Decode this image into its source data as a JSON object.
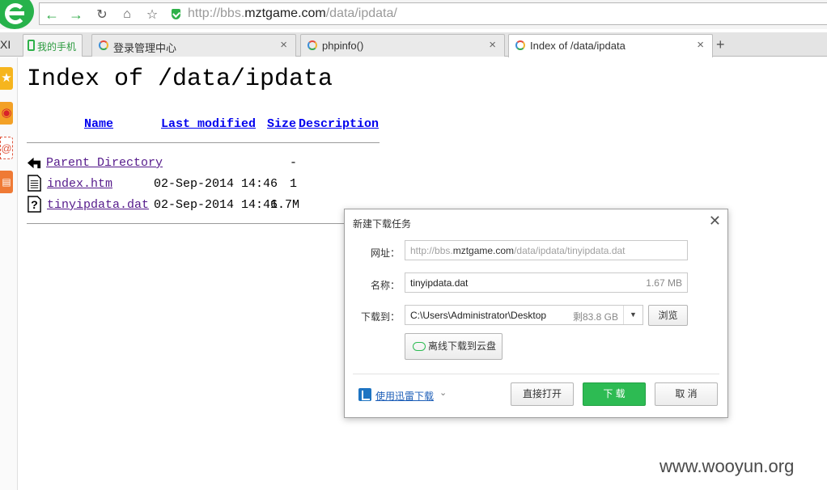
{
  "browser": {
    "url_prefix": "http://bbs.",
    "url_domain": "mztgame.com",
    "url_path": "/data/ipdata/",
    "tab_edge_label": "XI",
    "tabs": [
      {
        "label": "我的手机"
      },
      {
        "label": "登录管理中心"
      },
      {
        "label": "phpinfo()"
      },
      {
        "label": "Index of /data/ipdata"
      }
    ],
    "new_tab_label": "+"
  },
  "page": {
    "title": "Index of /data/ipdata",
    "columns": {
      "name": "Name",
      "last_modified": "Last modified",
      "size": "Size",
      "description": "Description"
    },
    "rows": [
      {
        "name": "Parent Directory",
        "modified": "",
        "size": "-",
        "icon": "back-icon"
      },
      {
        "name": "index.htm",
        "modified": "02-Sep-2014 14:46",
        "size": "1",
        "icon": "text-file-icon"
      },
      {
        "name": "tinyipdata.dat",
        "modified": "02-Sep-2014 14:46",
        "size": "1.7M",
        "icon": "unknown-file-icon"
      }
    ]
  },
  "dialog": {
    "title": "新建下载任务",
    "url_label": "网址：",
    "url_prefix": "http://bbs.",
    "url_domain": "mztgame.com",
    "url_path": "/data/ipdata/tinyipdata.dat",
    "name_label": "名称：",
    "name_value": "tinyipdata.dat",
    "name_size": "1.67 MB",
    "saveto_label": "下载到：",
    "saveto_value": "C:\\Users\\Administrator\\Desktop",
    "saveto_free": "剩83.8 GB",
    "browse_label": "浏览",
    "cloud_label": "离线下载到云盘",
    "thunder_label": "使用迅雷下载",
    "open_label": "直接打开",
    "download_label": "下 载",
    "cancel_label": "取 消",
    "primary_color": "#2dbb53"
  },
  "watermark": "www.wooyun.org"
}
